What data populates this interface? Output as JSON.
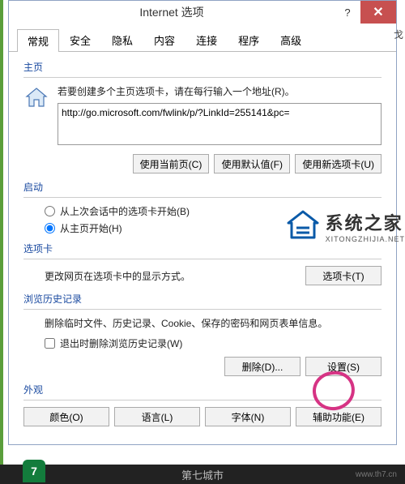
{
  "window": {
    "title": "Internet 选项",
    "help": "?",
    "close": "✕"
  },
  "tabs": [
    "常规",
    "安全",
    "隐私",
    "内容",
    "连接",
    "程序",
    "高级"
  ],
  "active_tab_index": 0,
  "homepage": {
    "group_title": "主页",
    "desc": "若要创建多个主页选项卡，请在每行输入一个地址(R)。",
    "url_value": "http://go.microsoft.com/fwlink/p/?LinkId=255141&pc=",
    "btn_current": "使用当前页(C)",
    "btn_default": "使用默认值(F)",
    "btn_newtab": "使用新选项卡(U)"
  },
  "startup": {
    "group_title": "启动",
    "radio1": "从上次会话中的选项卡开始(B)",
    "radio2": "从主页开始(H)",
    "selected": 1
  },
  "tabs_section": {
    "group_title": "选项卡",
    "desc": "更改网页在选项卡中的显示方式。",
    "btn": "选项卡(T)"
  },
  "history": {
    "group_title": "浏览历史记录",
    "desc": "删除临时文件、历史记录、Cookie、保存的密码和网页表单信息。",
    "checkbox": "退出时删除浏览历史记录(W)",
    "btn_delete": "删除(D)...",
    "btn_settings": "设置(S)"
  },
  "appearance": {
    "group_title": "外观",
    "btn_color": "颜色(O)",
    "btn_lang": "语言(L)",
    "btn_font": "字体(N)",
    "btn_access": "辅助功能(E)"
  },
  "watermark": {
    "title": "系统之家",
    "sub": "XITONGZHIJIA.NET"
  },
  "footer": {
    "text": "第七城市",
    "site": "www.th7.cn",
    "logo": "7"
  },
  "extra_char": "戈"
}
